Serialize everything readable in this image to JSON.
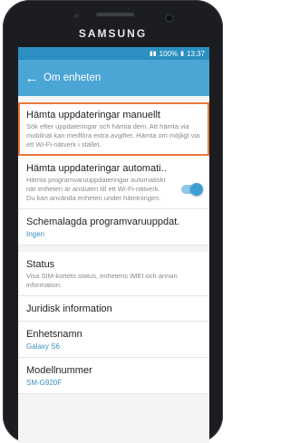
{
  "device": {
    "brand": "SAMSUNG"
  },
  "statusbar": {
    "battery": "100%",
    "time": "13:37"
  },
  "appbar": {
    "title": "Om enheten"
  },
  "items": [
    {
      "title": "Hämta uppdateringar manuellt",
      "desc": "Sök efter uppdateringar och hämta dem. Att hämta via mobilnät kan medföra extra avgifter. Hämta om möjligt via ett Wi-Fi-nätverk i stället."
    },
    {
      "title": "Hämta uppdateringar automati..",
      "desc": "Hämta programvaruuppdateringar automatiskt när enheten är ansluten till ett Wi-Fi-nätverk. Du kan använda enheten under hämtningen.",
      "toggle_on": true
    },
    {
      "title": "Schemalagda programvaruuppdat.",
      "sub": "Ingen"
    },
    {
      "title": "Status",
      "desc": "Visa SIM-kortets status, enhetens IMEI och annan information."
    },
    {
      "title": "Juridisk information"
    },
    {
      "title": "Enhetsnamn",
      "sub": "Galaxy S6"
    },
    {
      "title": "Modellnummer",
      "sub": "SM-G920F"
    }
  ],
  "colors": {
    "accent": "#4ba6d6",
    "highlight": "#e97a3a"
  }
}
